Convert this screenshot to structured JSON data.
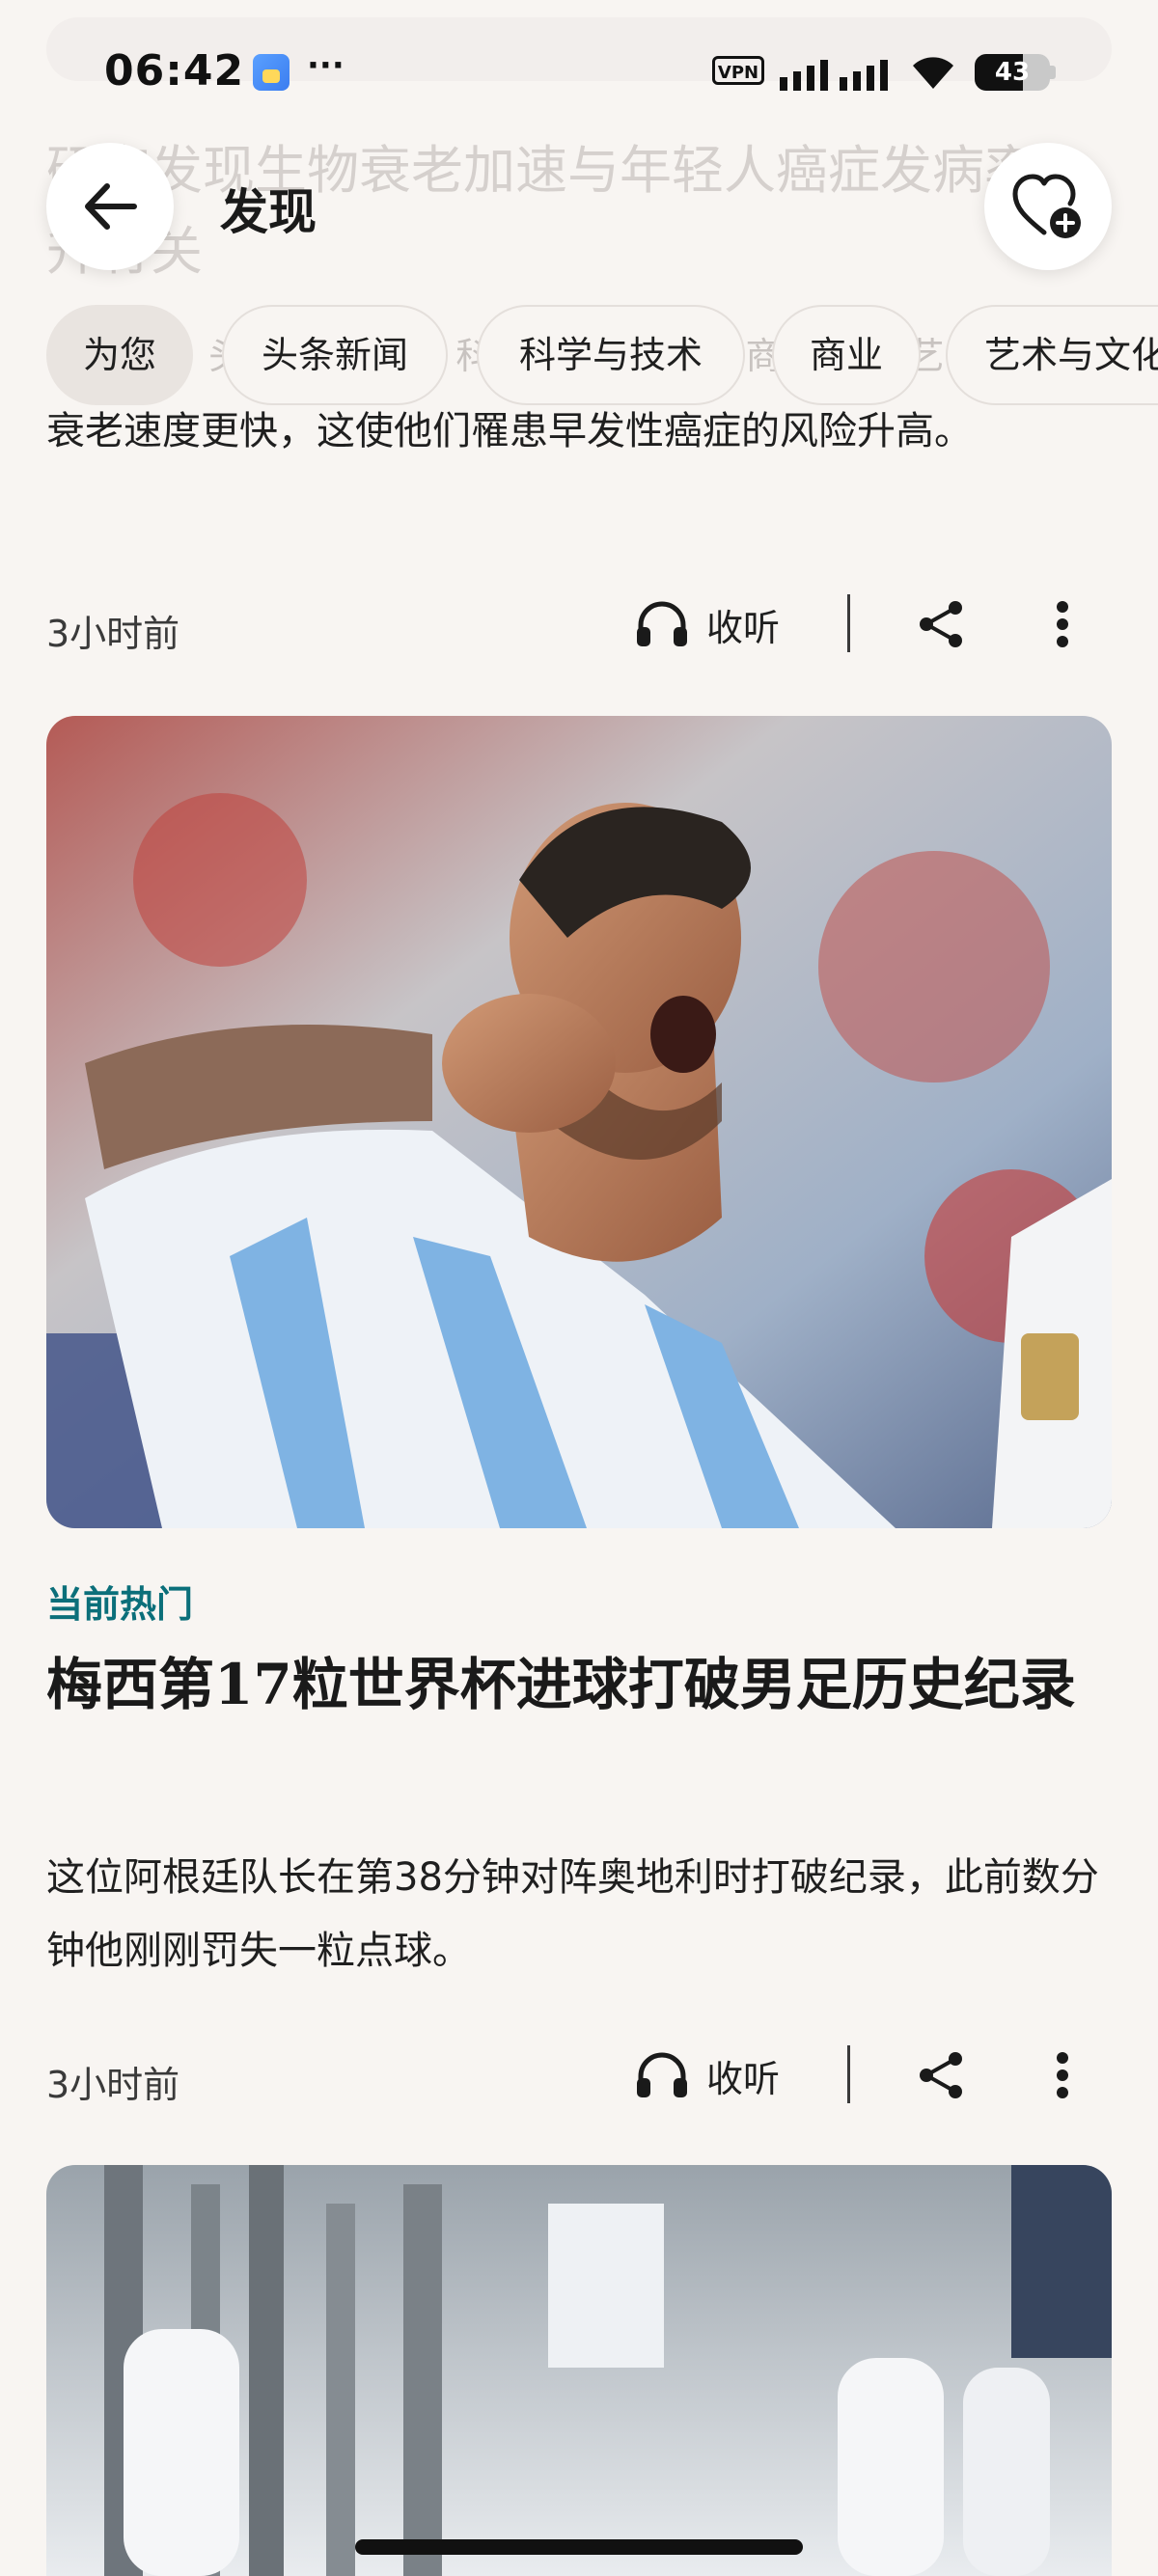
{
  "status_bar": {
    "time": "06:42",
    "more": "···",
    "vpn": "VPN",
    "battery": "43"
  },
  "header": {
    "title": "发现",
    "back_icon": "arrow-left-icon",
    "favorite_icon": "heart-plus-icon"
  },
  "faded_article_title": "研究发现生物衰老加速与年轻人癌症发病率上升有关",
  "tabs": {
    "behind_text": "为您  表  头条新闻  学  科学与技术  现  商业  论  艺术与文化",
    "items": [
      {
        "label": "为您",
        "active": true
      },
      {
        "label": "头条新闻",
        "active": false
      },
      {
        "label": "科学与技术",
        "active": false
      },
      {
        "label": "商业",
        "active": false
      },
      {
        "label": "艺术与文化",
        "active": false
      }
    ]
  },
  "article_1": {
    "partial_text": "衰老速度更快，这使他们罹患早发性癌症的风险升高。",
    "time": "3小时前",
    "listen_label": "收听"
  },
  "article_2": {
    "category": "当前热门",
    "headline": "梅西第17粒世界杯进球打破男足历史纪录",
    "summary": "这位阿根廷队长在第38分钟对阵奥地利时打破纪录，此前数分钟他刚刚罚失一粒点球。",
    "time": "3小时前",
    "listen_label": "收听"
  },
  "colors": {
    "background": "#f8f5f2",
    "category_accent": "#0b6f7a",
    "text_primary": "#1f1f1f"
  }
}
